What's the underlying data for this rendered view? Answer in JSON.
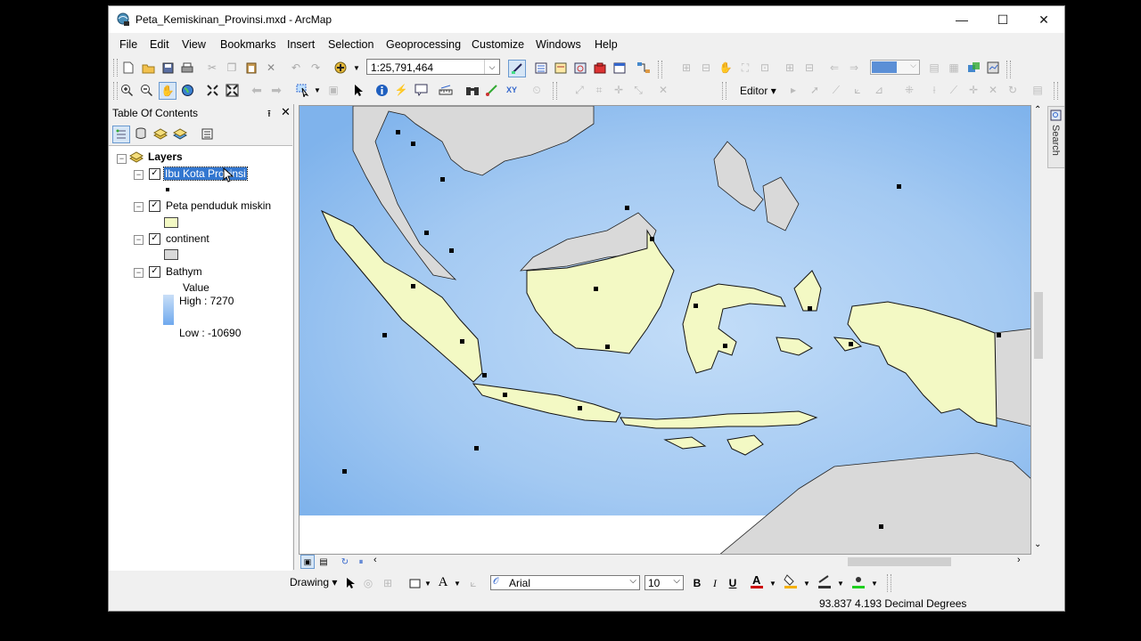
{
  "window": {
    "title": "Peta_Kemiskinan_Provinsi.mxd - ArcMap",
    "minimize": "—",
    "maximize": "☐",
    "close": "✕"
  },
  "menu": [
    "File",
    "Edit",
    "View",
    "Bookmarks",
    "Insert",
    "Selection",
    "Geoprocessing",
    "Customize",
    "Windows",
    "Help"
  ],
  "toolbar": {
    "scale": "1:25,791,464",
    "editor_label": "Editor",
    "editor_arrow": "▾"
  },
  "toc": {
    "title": "Table Of Contents",
    "pin": "⭱",
    "close": "✕",
    "root_label": "Layers",
    "layers": [
      {
        "name": "Ibu Kota Provinsi",
        "checked": true,
        "selected": true
      },
      {
        "name": "Peta penduduk miskin",
        "checked": true,
        "selected": false
      },
      {
        "name": "continent",
        "checked": true,
        "selected": false
      },
      {
        "name": "Bathym",
        "checked": true,
        "selected": false
      }
    ],
    "bathym_legend": {
      "field": "Value",
      "high": "High : 7270",
      "low": "Low : -10690"
    },
    "colors": {
      "province_fill": "#f3f9c4",
      "continent_fill": "#d9d9d9",
      "bathym_high": "#c9dff7",
      "bathym_low": "#6fa9ee"
    }
  },
  "side_panel": {
    "search_tab": "Search"
  },
  "drawing_toolbar": {
    "drawing_label": "Drawing",
    "font_name": "Arial",
    "font_size": "10",
    "bold": "B",
    "italic": "I",
    "underline": "U",
    "text_tool": "A"
  },
  "status_bar": {
    "coordinates": "93.837  4.193 Decimal Degrees"
  },
  "map": {
    "ocean_color": "#a9cdf3",
    "land_color": "#d9d9d9",
    "indonesia_color": "#f3f9c4"
  }
}
